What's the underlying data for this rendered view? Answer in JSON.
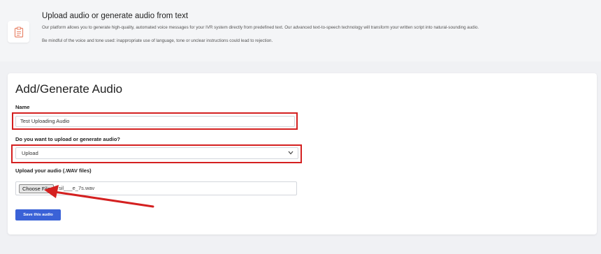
{
  "banner": {
    "icon": "clipboard-icon",
    "title": "Upload audio or generate audio from text",
    "description": "Our platform allows you to generate high-quality, automated voice messages for your IVR system directly from predefined text. Our advanced text-to-speech technology will transform your written script into natural-sounding audio.",
    "note": "Be mindful of the voice and tone used: inappropriate use of language, tone or unclear instructions could lead to rejection."
  },
  "form": {
    "title": "Add/Generate Audio",
    "name_label": "Name",
    "name_value": "Test Uploading Audio",
    "mode_label": "Do you want to upload or generate audio?",
    "mode_value": "Upload",
    "upload_label": "Upload your audio (.WAV files)",
    "choose_file_label": "Choose File",
    "file_name": "sil___e_7s.wav",
    "save_label": "Save this audio"
  },
  "annotations": {
    "highlight_color": "#d42020",
    "arrow_color": "#d42020"
  },
  "colors": {
    "primary": "#3a62d7",
    "background": "#f0f1f4"
  }
}
